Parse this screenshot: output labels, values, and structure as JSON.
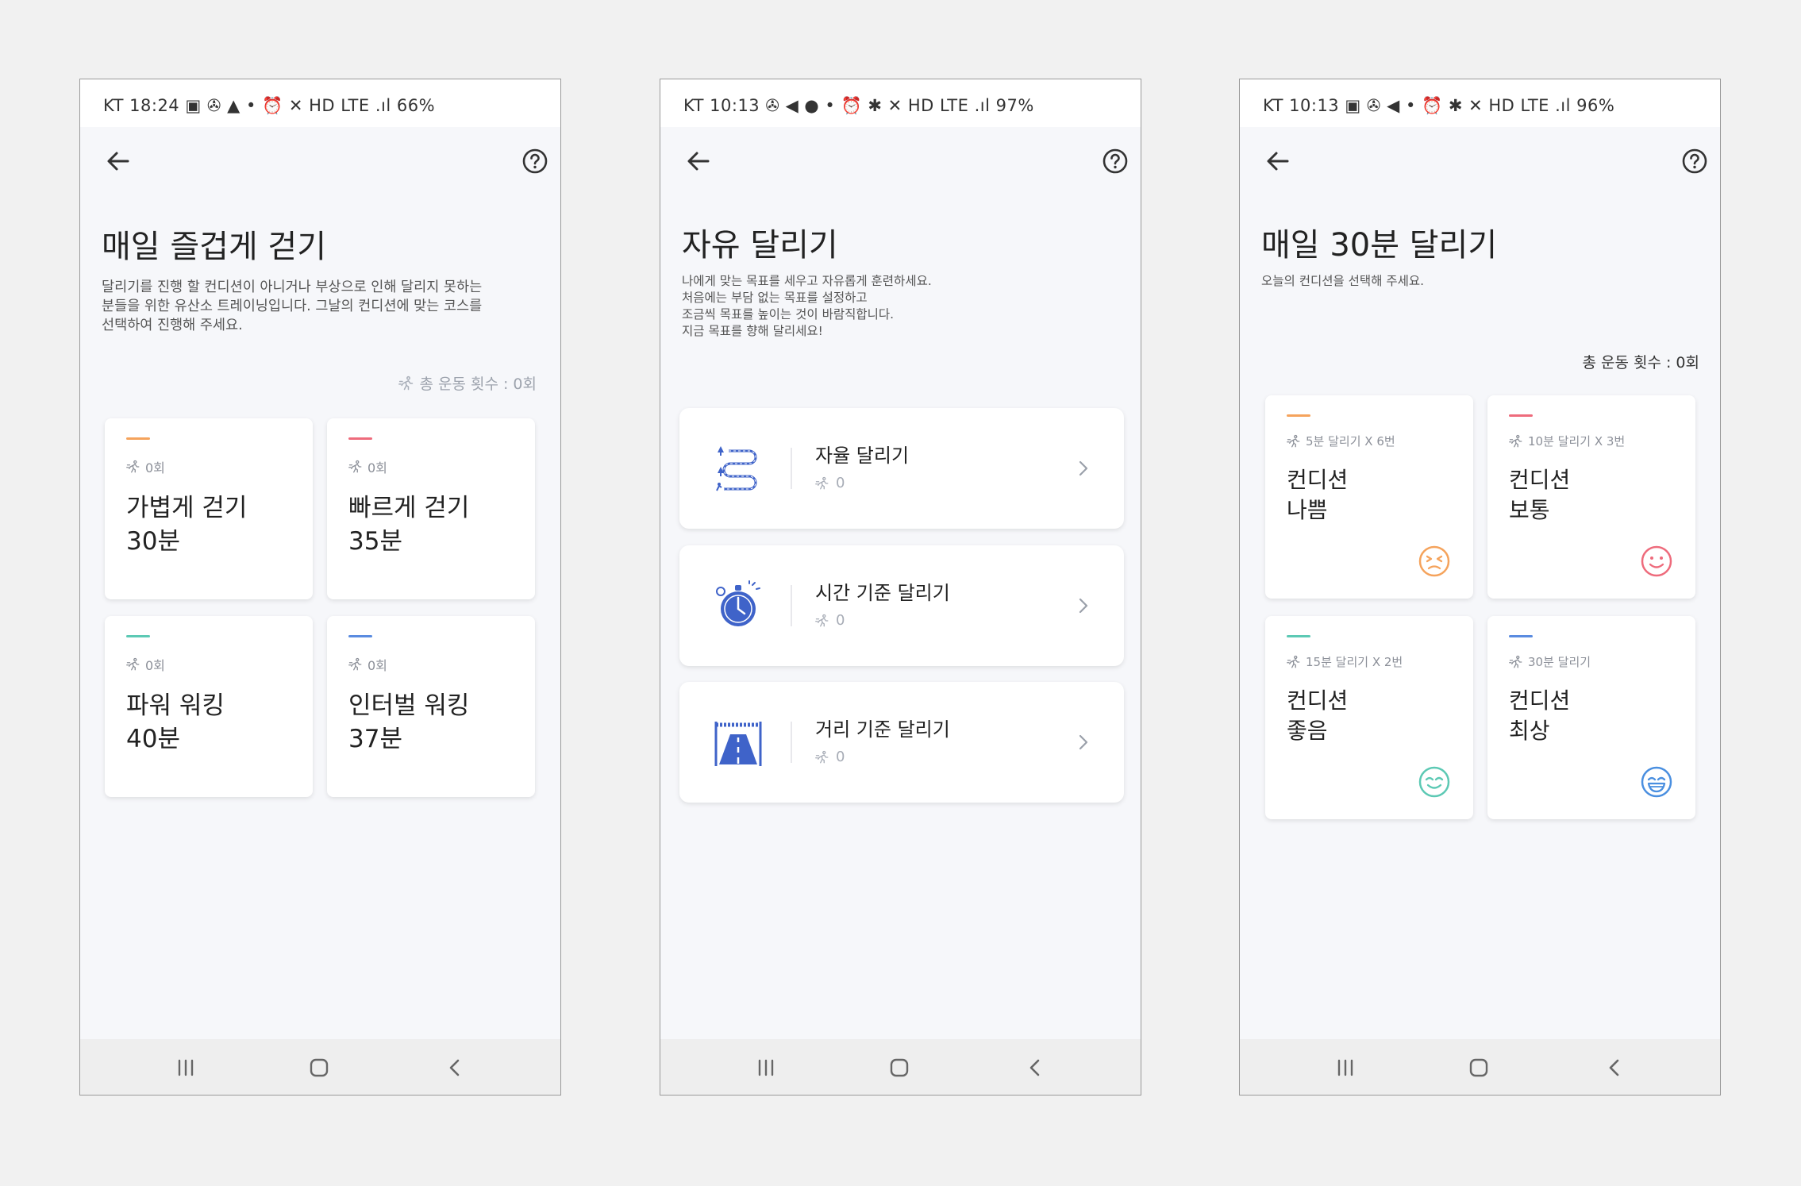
{
  "colors": {
    "orange": "#f5a35c",
    "red": "#ee6b7c",
    "teal": "#5cc9b4",
    "blue": "#5a8be0"
  },
  "icons": {
    "back": "arrow-left-icon",
    "help": "help-circle-icon",
    "runner": "runner-icon",
    "chevron": "chevron-right-icon",
    "nav_recents": "recents-icon",
    "nav_home": "home-icon",
    "nav_back": "nav-back-icon"
  },
  "screen1": {
    "status": "KT 18:24 ▣ ✇ ▲ •        ⏰ ✕ HD LTE .ıl 66%",
    "title": "매일 즐겁게 걷기",
    "description": "달리기를 진행 할 컨디션이 아니거나 부상으로 인해 달리지 못하는\n분들을 위한 유산소 트레이닝입니다. 그날의 컨디션에 맞는 코스를\n선택하여 진행해 주세요.",
    "total": "총 운동 횟수 : 0회",
    "cards": [
      {
        "count": "0회",
        "name": "가볍게 걷기\n30분"
      },
      {
        "count": "0회",
        "name": "빠르게 걷기\n35분"
      },
      {
        "count": "0회",
        "name": "파워 워킹\n40분"
      },
      {
        "count": "0회",
        "name": "인터벌 워킹\n37분"
      }
    ]
  },
  "screen2": {
    "status": "KT 10:13 ✇ ◀ ● •  ⏰ ✱ ✕ HD LTE .ıl 97%",
    "title": "자유 달리기",
    "description": "나에게 맞는 목표를 세우고 자유롭게 훈련하세요.\n처음에는 부담 없는 목표를 설정하고\n조금씩 목표를 높이는 것이 바람직합니다.\n지금 목표를 향해 달리세요!",
    "items": [
      {
        "name": "자율 달리기",
        "count": "0"
      },
      {
        "name": "시간 기준 달리기",
        "count": "0"
      },
      {
        "name": "거리 기준 달리기",
        "count": "0"
      }
    ]
  },
  "screen3": {
    "status": "KT 10:13 ▣ ✇ ◀ •  ⏰ ✱ ✕ HD LTE .ıl 96%",
    "title": "매일 30분 달리기",
    "description": "오늘의 컨디션을 선택해 주세요.",
    "total": "총 운동 횟수 : 0회",
    "cards": [
      {
        "meta": "5분 달리기 X 6번",
        "name": "컨디션\n나쁨"
      },
      {
        "meta": "10분 달리기 X 3번",
        "name": "컨디션\n보통"
      },
      {
        "meta": "15분 달리기 X 2번",
        "name": "컨디션\n좋음"
      },
      {
        "meta": "30분 달리기",
        "name": "컨디션\n최상"
      }
    ]
  }
}
